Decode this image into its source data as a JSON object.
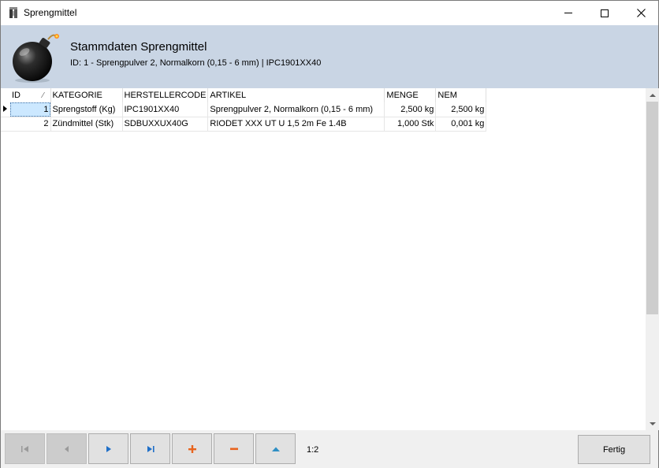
{
  "window": {
    "title": "Sprengmittel"
  },
  "header": {
    "title": "Stammdaten Sprengmittel",
    "subtitle": "ID: 1 - Sprengpulver 2, Normalkorn (0,15 - 6 mm) | IPC1901XX40"
  },
  "grid": {
    "columns": [
      "ID",
      "KATEGORIE",
      "HERSTELLERCODE",
      "ARTIKEL",
      "MENGE",
      "NEM"
    ],
    "rows": [
      {
        "id": "1",
        "kategorie": "Sprengstoff (Kg)",
        "herstellercode": "IPC1901XX40",
        "artikel": "Sprengpulver 2, Normalkorn (0,15 - 6 mm)",
        "menge": "2,500 kg",
        "nem": "2,500 kg"
      },
      {
        "id": "2",
        "kategorie": "Zündmittel (Stk)",
        "herstellercode": "SDBUXXUX40G",
        "artikel": "RIODET XXX UT U 1,5 2m Fe 1.4B",
        "menge": "1,000 Stk",
        "nem": "0,001 kg"
      }
    ]
  },
  "toolbar": {
    "counter": "1:2",
    "fertig_label": "Fertig"
  },
  "colors": {
    "header_bg": "#c9d5e4",
    "add_icon": "#e8641e",
    "remove_icon": "#e8641e",
    "nav_icon": "#1f6fc8",
    "up_icon": "#2e8fc4"
  },
  "icons": [
    "first-icon",
    "prev-icon",
    "next-icon",
    "last-icon",
    "plus-icon",
    "minus-icon",
    "up-icon",
    "bomb-icon"
  ]
}
